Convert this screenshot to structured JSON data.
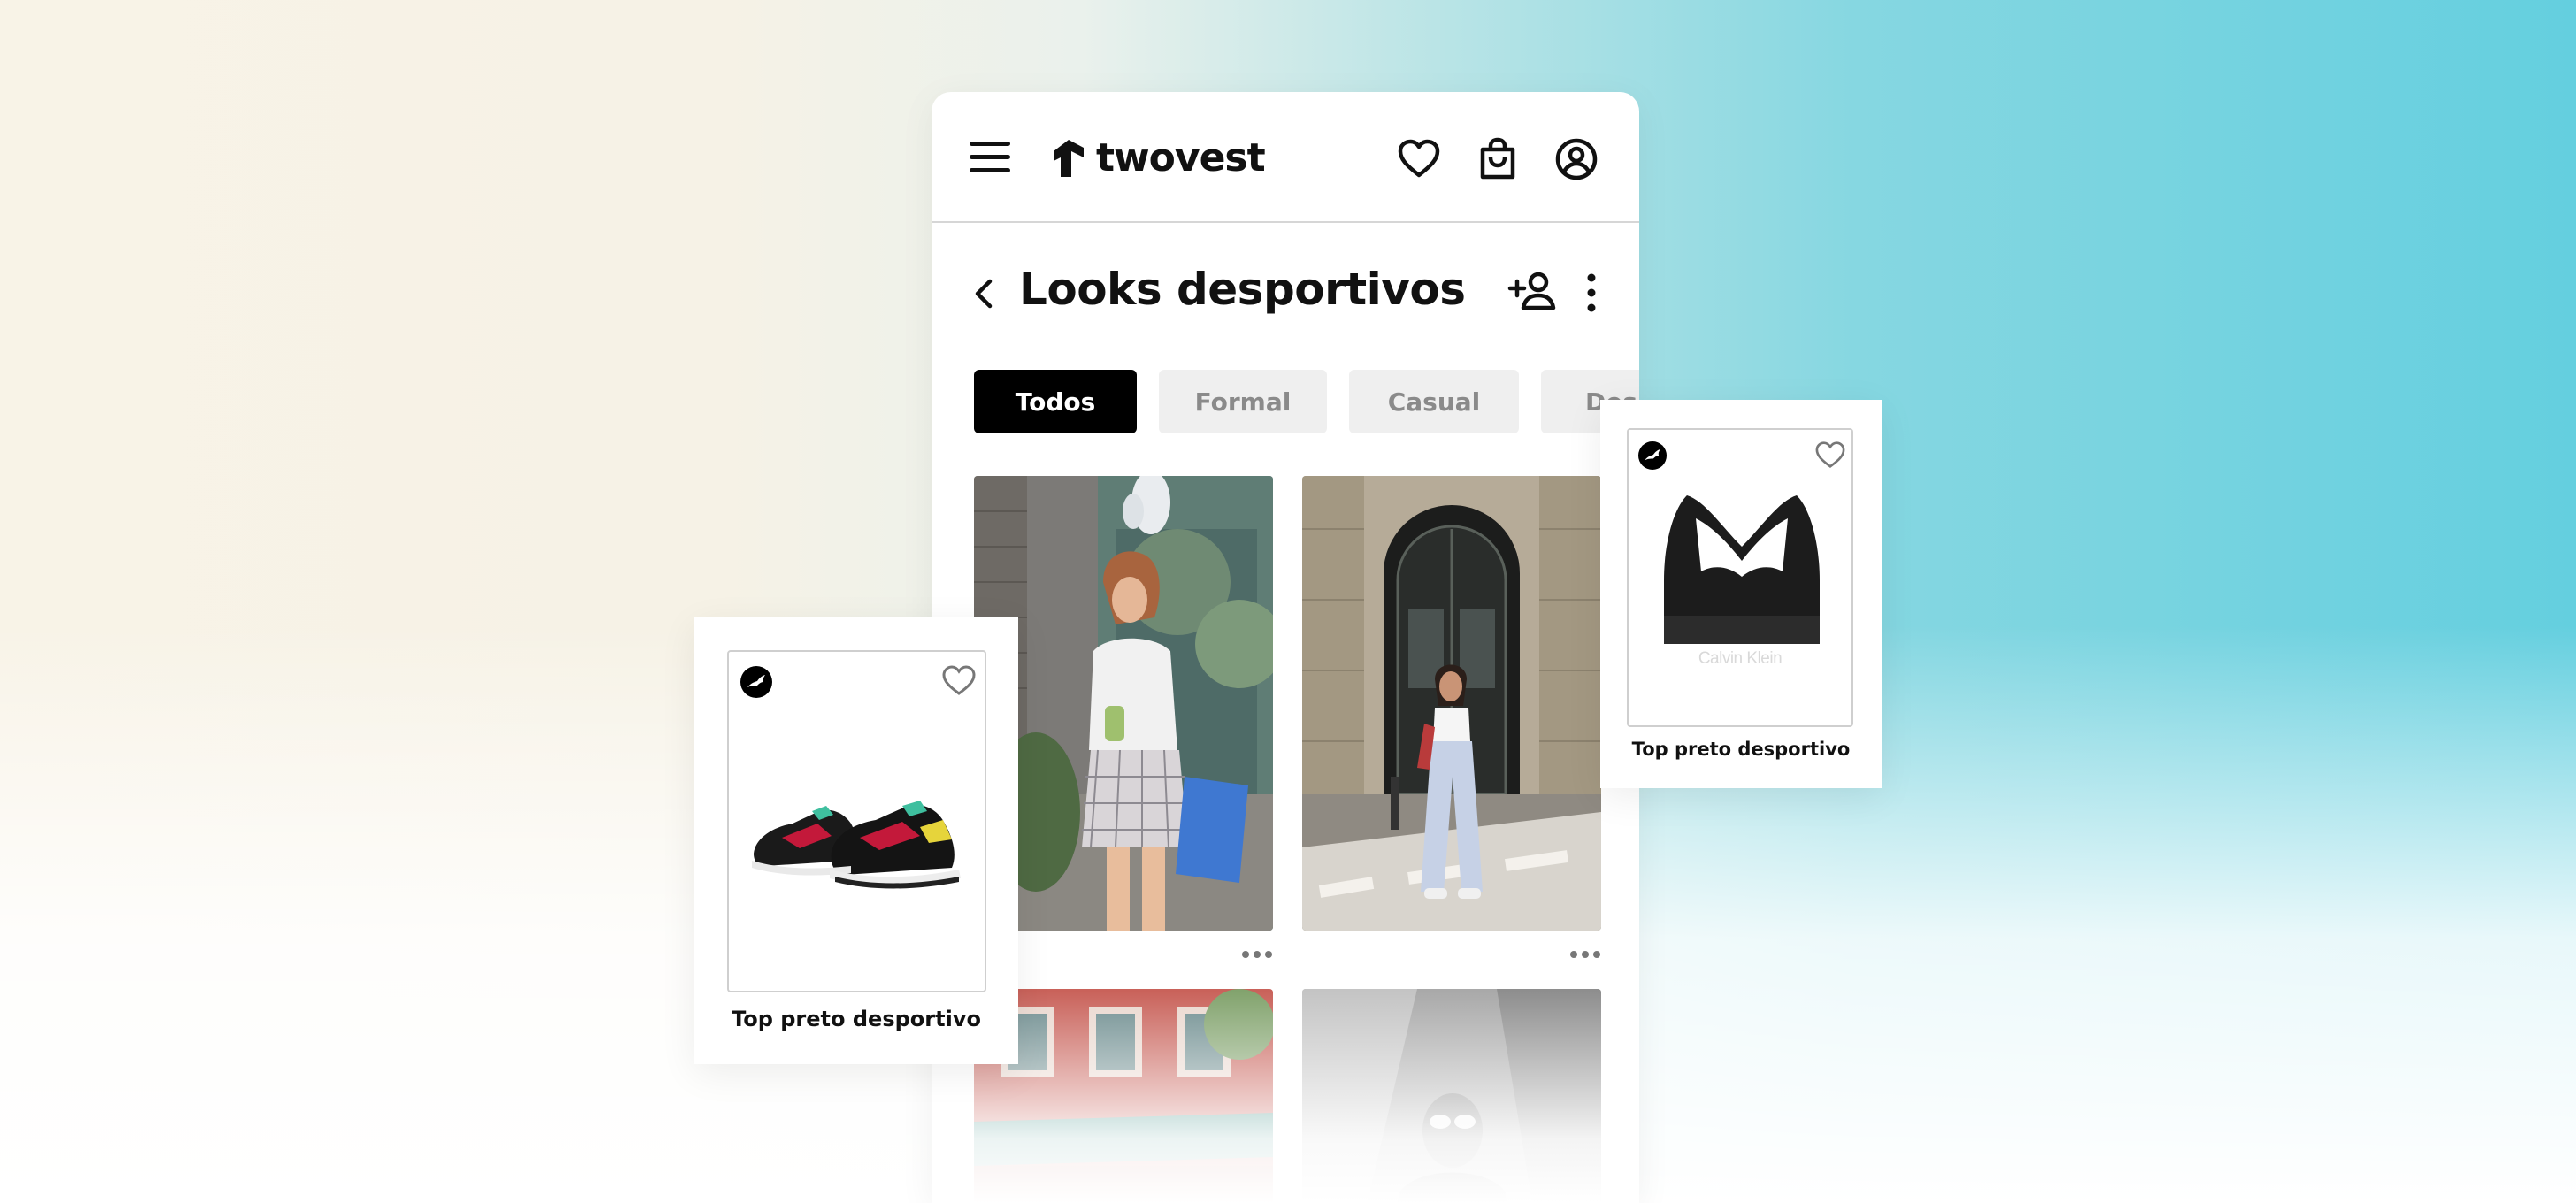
{
  "app": {
    "brand": "twovest"
  },
  "page": {
    "title": "Looks desportivos"
  },
  "filters": [
    {
      "label": "Todos",
      "active": true
    },
    {
      "label": "Formal",
      "active": false
    },
    {
      "label": "Casual",
      "active": false
    },
    {
      "label": "Des",
      "active": false
    }
  ],
  "icons": {
    "menu": "hamburger-menu-icon",
    "wishlist": "heart-icon",
    "bag": "shopping-bag-icon",
    "account": "user-circle-icon",
    "back": "chevron-left-icon",
    "add_user": "add-user-icon",
    "more": "more-vertical-icon",
    "post_options": "more-horizontal-icon"
  },
  "looks": [
    {
      "description_hidden": true
    },
    {
      "description_hidden": true
    },
    {
      "description_hidden": true
    },
    {
      "description_hidden": true
    }
  ],
  "products": [
    {
      "name": "Top preto desportivo",
      "brand_logo": "puma-logo"
    },
    {
      "name": "Top preto desportivo",
      "brand_logo": "puma-logo",
      "garment_print": "Calvin Klein"
    }
  ],
  "colors": {
    "accent": "#000000",
    "chip_inactive_bg": "#efefef",
    "chip_inactive_text": "#8a8a8a"
  }
}
